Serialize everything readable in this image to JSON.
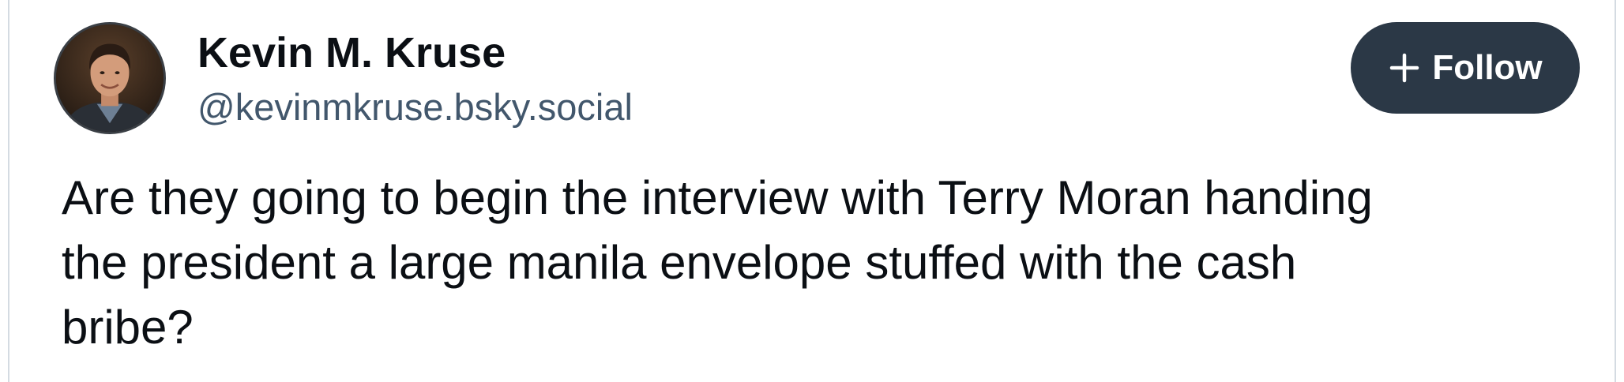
{
  "author": {
    "display_name": "Kevin M. Kruse",
    "handle": "@kevinmkruse.bsky.social",
    "avatar_icon": "profile-photo"
  },
  "follow_button": {
    "label": "Follow",
    "icon": "plus-icon",
    "background": "#2b3846",
    "text_color": "#ffffff"
  },
  "post": {
    "text": "Are they going to begin the interview with Terry Moran handing\nthe president a large manila envelope stuffed with the cash\nbribe?"
  },
  "colors": {
    "name": "#0b0f14",
    "handle": "#42576c",
    "border": "#d4dbe2"
  }
}
